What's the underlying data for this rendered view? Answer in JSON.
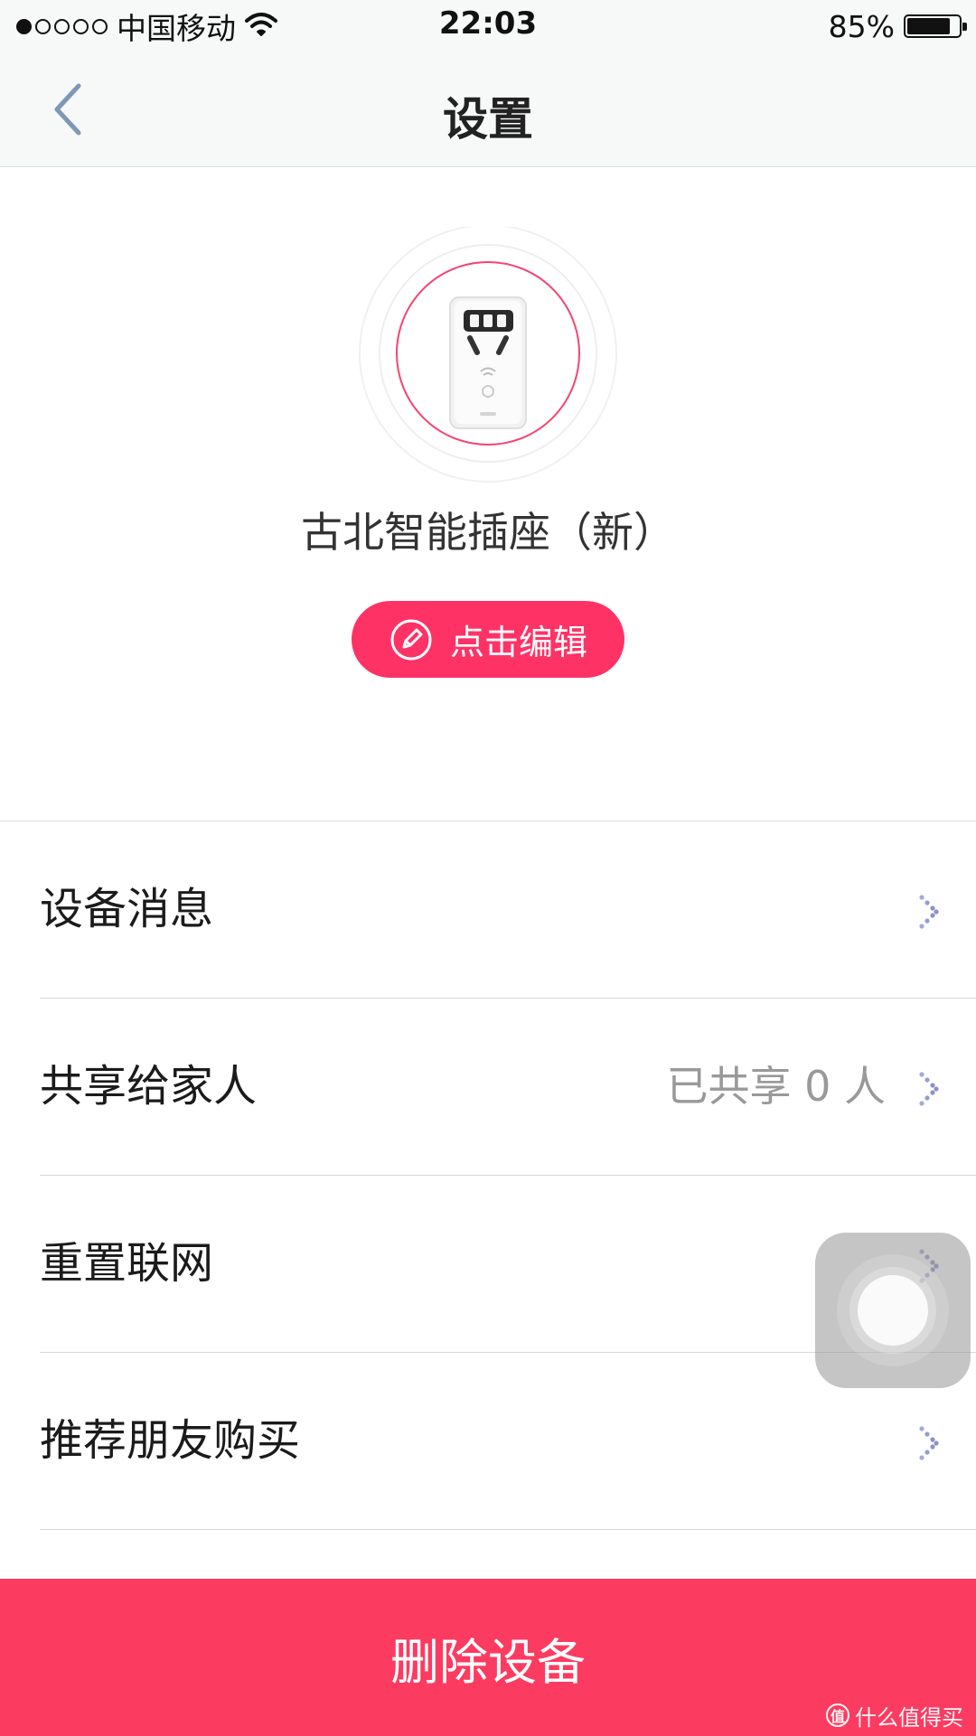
{
  "status_bar": {
    "signal_dots_filled": 1,
    "signal_dots_total": 5,
    "carrier": "中国移动",
    "time": "22:03",
    "battery_text": "85%",
    "battery_level": 0.85
  },
  "nav": {
    "title": "设置",
    "back_icon": "chevron-left-icon"
  },
  "device": {
    "image": "smart-plug-image",
    "name": "古北智能插座（新）",
    "edit_label": "点击编辑",
    "edit_icon": "pencil-circle-icon"
  },
  "settings": [
    {
      "label": "设备消息",
      "value": ""
    },
    {
      "label": "共享给家人",
      "value": "已共享 0 人"
    },
    {
      "label": "重置联网",
      "value": ""
    },
    {
      "label": "推荐朋友购买",
      "value": ""
    }
  ],
  "delete_label": "删除设备",
  "watermark": {
    "badge": "值",
    "text": "什么值得买"
  },
  "colors": {
    "accent": "#ff3266",
    "delete": "#fc3b61",
    "back_icon": "#7f97b8",
    "chevron": "#8b92c9"
  }
}
